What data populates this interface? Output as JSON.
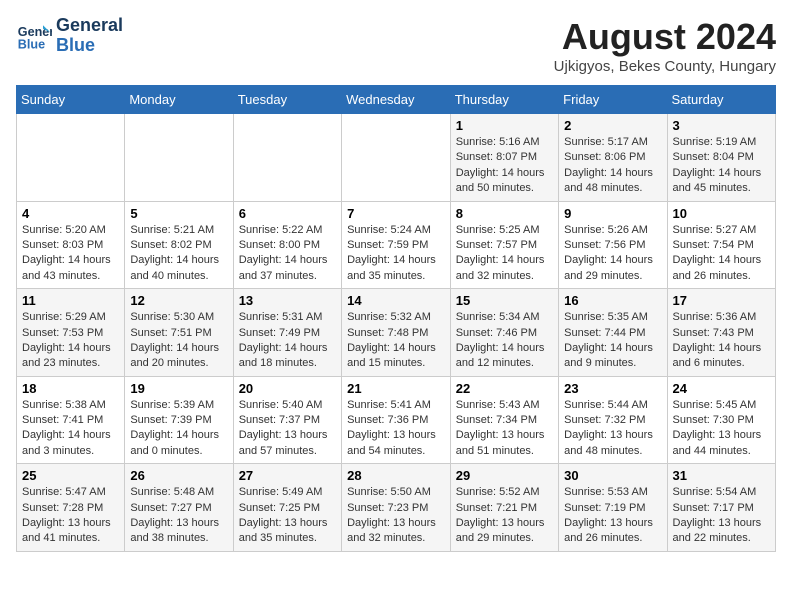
{
  "header": {
    "logo_line1": "General",
    "logo_line2": "Blue",
    "title": "August 2024",
    "subtitle": "Ujkigyos, Bekes County, Hungary"
  },
  "days_of_week": [
    "Sunday",
    "Monday",
    "Tuesday",
    "Wednesday",
    "Thursday",
    "Friday",
    "Saturday"
  ],
  "weeks": [
    [
      {
        "day": "",
        "info": ""
      },
      {
        "day": "",
        "info": ""
      },
      {
        "day": "",
        "info": ""
      },
      {
        "day": "",
        "info": ""
      },
      {
        "day": "1",
        "info": "Sunrise: 5:16 AM\nSunset: 8:07 PM\nDaylight: 14 hours and 50 minutes."
      },
      {
        "day": "2",
        "info": "Sunrise: 5:17 AM\nSunset: 8:06 PM\nDaylight: 14 hours and 48 minutes."
      },
      {
        "day": "3",
        "info": "Sunrise: 5:19 AM\nSunset: 8:04 PM\nDaylight: 14 hours and 45 minutes."
      }
    ],
    [
      {
        "day": "4",
        "info": "Sunrise: 5:20 AM\nSunset: 8:03 PM\nDaylight: 14 hours and 43 minutes."
      },
      {
        "day": "5",
        "info": "Sunrise: 5:21 AM\nSunset: 8:02 PM\nDaylight: 14 hours and 40 minutes."
      },
      {
        "day": "6",
        "info": "Sunrise: 5:22 AM\nSunset: 8:00 PM\nDaylight: 14 hours and 37 minutes."
      },
      {
        "day": "7",
        "info": "Sunrise: 5:24 AM\nSunset: 7:59 PM\nDaylight: 14 hours and 35 minutes."
      },
      {
        "day": "8",
        "info": "Sunrise: 5:25 AM\nSunset: 7:57 PM\nDaylight: 14 hours and 32 minutes."
      },
      {
        "day": "9",
        "info": "Sunrise: 5:26 AM\nSunset: 7:56 PM\nDaylight: 14 hours and 29 minutes."
      },
      {
        "day": "10",
        "info": "Sunrise: 5:27 AM\nSunset: 7:54 PM\nDaylight: 14 hours and 26 minutes."
      }
    ],
    [
      {
        "day": "11",
        "info": "Sunrise: 5:29 AM\nSunset: 7:53 PM\nDaylight: 14 hours and 23 minutes."
      },
      {
        "day": "12",
        "info": "Sunrise: 5:30 AM\nSunset: 7:51 PM\nDaylight: 14 hours and 20 minutes."
      },
      {
        "day": "13",
        "info": "Sunrise: 5:31 AM\nSunset: 7:49 PM\nDaylight: 14 hours and 18 minutes."
      },
      {
        "day": "14",
        "info": "Sunrise: 5:32 AM\nSunset: 7:48 PM\nDaylight: 14 hours and 15 minutes."
      },
      {
        "day": "15",
        "info": "Sunrise: 5:34 AM\nSunset: 7:46 PM\nDaylight: 14 hours and 12 minutes."
      },
      {
        "day": "16",
        "info": "Sunrise: 5:35 AM\nSunset: 7:44 PM\nDaylight: 14 hours and 9 minutes."
      },
      {
        "day": "17",
        "info": "Sunrise: 5:36 AM\nSunset: 7:43 PM\nDaylight: 14 hours and 6 minutes."
      }
    ],
    [
      {
        "day": "18",
        "info": "Sunrise: 5:38 AM\nSunset: 7:41 PM\nDaylight: 14 hours and 3 minutes."
      },
      {
        "day": "19",
        "info": "Sunrise: 5:39 AM\nSunset: 7:39 PM\nDaylight: 14 hours and 0 minutes."
      },
      {
        "day": "20",
        "info": "Sunrise: 5:40 AM\nSunset: 7:37 PM\nDaylight: 13 hours and 57 minutes."
      },
      {
        "day": "21",
        "info": "Sunrise: 5:41 AM\nSunset: 7:36 PM\nDaylight: 13 hours and 54 minutes."
      },
      {
        "day": "22",
        "info": "Sunrise: 5:43 AM\nSunset: 7:34 PM\nDaylight: 13 hours and 51 minutes."
      },
      {
        "day": "23",
        "info": "Sunrise: 5:44 AM\nSunset: 7:32 PM\nDaylight: 13 hours and 48 minutes."
      },
      {
        "day": "24",
        "info": "Sunrise: 5:45 AM\nSunset: 7:30 PM\nDaylight: 13 hours and 44 minutes."
      }
    ],
    [
      {
        "day": "25",
        "info": "Sunrise: 5:47 AM\nSunset: 7:28 PM\nDaylight: 13 hours and 41 minutes."
      },
      {
        "day": "26",
        "info": "Sunrise: 5:48 AM\nSunset: 7:27 PM\nDaylight: 13 hours and 38 minutes."
      },
      {
        "day": "27",
        "info": "Sunrise: 5:49 AM\nSunset: 7:25 PM\nDaylight: 13 hours and 35 minutes."
      },
      {
        "day": "28",
        "info": "Sunrise: 5:50 AM\nSunset: 7:23 PM\nDaylight: 13 hours and 32 minutes."
      },
      {
        "day": "29",
        "info": "Sunrise: 5:52 AM\nSunset: 7:21 PM\nDaylight: 13 hours and 29 minutes."
      },
      {
        "day": "30",
        "info": "Sunrise: 5:53 AM\nSunset: 7:19 PM\nDaylight: 13 hours and 26 minutes."
      },
      {
        "day": "31",
        "info": "Sunrise: 5:54 AM\nSunset: 7:17 PM\nDaylight: 13 hours and 22 minutes."
      }
    ]
  ]
}
